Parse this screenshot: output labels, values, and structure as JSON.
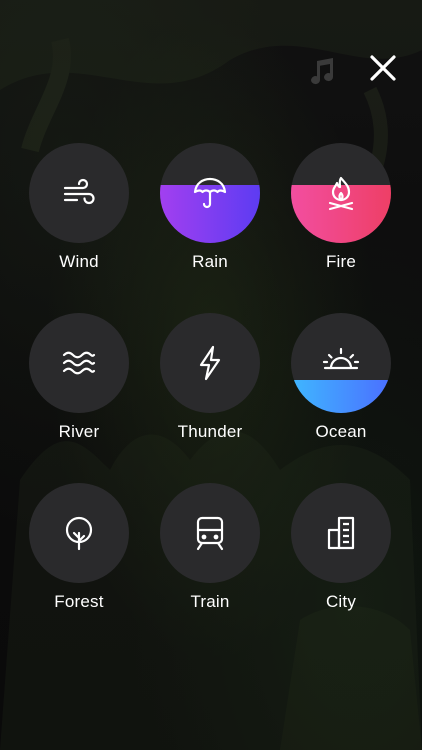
{
  "topbar": {
    "music_icon": "music-note-icon",
    "close_icon": "close-icon"
  },
  "sounds": [
    {
      "label": "Wind",
      "icon": "wind-icon",
      "level": 0,
      "gradient": null
    },
    {
      "label": "Rain",
      "icon": "umbrella-icon",
      "level": 0.58,
      "gradient": [
        "#a23ff0",
        "#5d3cf2"
      ]
    },
    {
      "label": "Fire",
      "icon": "campfire-icon",
      "level": 0.58,
      "gradient": [
        "#f24ea0",
        "#ee3f66"
      ]
    },
    {
      "label": "River",
      "icon": "waves-icon",
      "level": 0,
      "gradient": null
    },
    {
      "label": "Thunder",
      "icon": "lightning-icon",
      "level": 0,
      "gradient": null
    },
    {
      "label": "Ocean",
      "icon": "sunset-icon",
      "level": 0.33,
      "gradient": [
        "#3fb7ff",
        "#4b6fff"
      ]
    },
    {
      "label": "Forest",
      "icon": "tree-icon",
      "level": 0,
      "gradient": null
    },
    {
      "label": "Train",
      "icon": "train-icon",
      "level": 0,
      "gradient": null
    },
    {
      "label": "City",
      "icon": "building-icon",
      "level": 0,
      "gradient": null
    }
  ]
}
